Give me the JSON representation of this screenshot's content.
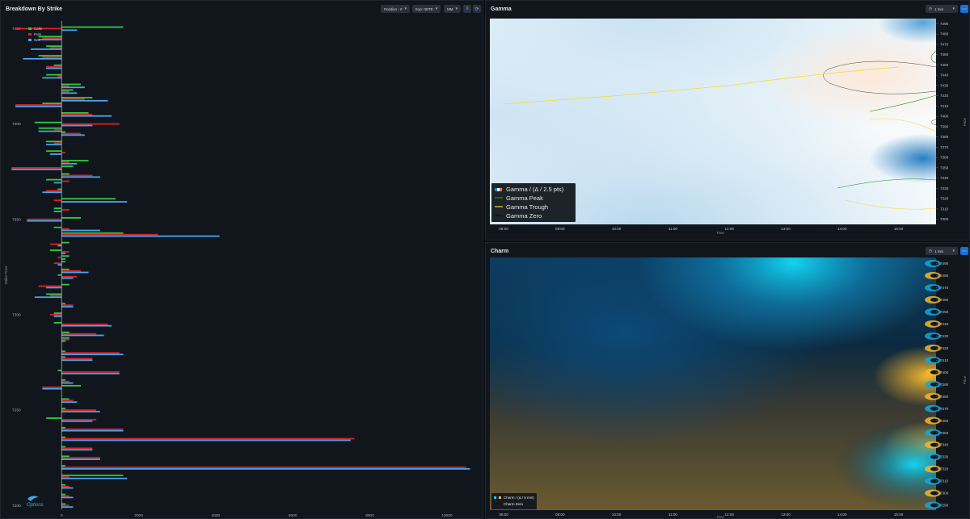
{
  "left_panel": {
    "title": "Breakdown By Strike",
    "position_select": "Position - #",
    "expiry_select": "Exp: 0DTE",
    "mm_select": "MM",
    "y_axis_label": "Strike Price",
    "legend": [
      {
        "label": "Calls",
        "color": "#2ecc3a"
      },
      {
        "label": "Puts",
        "color": "#e01f24"
      },
      {
        "label": "Net",
        "color": "#4aa3f0"
      }
    ],
    "logo_text": "Options"
  },
  "gamma_panel": {
    "title": "Gamma",
    "interval_select": "1 min",
    "x_axis_label": "Time",
    "y_axis_label": "Price",
    "legend": [
      {
        "label": "Gamma / (Δ / 2.5 pts)"
      },
      {
        "label": "Gamma Peak"
      },
      {
        "label": "Gamma Trough"
      },
      {
        "label": "Gamma Zero"
      }
    ]
  },
  "charm_panel": {
    "title": "Charm",
    "interval_select": "1 min",
    "x_axis_label": "Time",
    "y_axis_label": "Price",
    "legend": [
      {
        "label": "Charm / (Δ / 5 min)"
      },
      {
        "label": "Charm Zero"
      }
    ]
  },
  "colors": {
    "calls": "#2ecc3a",
    "puts": "#e01f24",
    "net": "#4aa3f0",
    "gamma_peak": "#1f8a1f",
    "gamma_trough": "#f0e030",
    "charm_positive": "#f2b630",
    "charm_negative": "#12d4f2"
  },
  "chart_data": [
    {
      "type": "bar",
      "orientation": "horizontal",
      "title": "Breakdown By Strike",
      "ylabel": "Strike Price",
      "y_tick_labels": [
        "7450",
        "7400",
        "7350",
        "7300",
        "7250",
        "7200"
      ],
      "x_tick_labels": [
        "0",
        "2000",
        "4000",
        "6000",
        "8000",
        "10000"
      ],
      "xlim": [
        -1200,
        10800
      ],
      "ylim": [
        7198,
        7454
      ],
      "series": [
        {
          "name": "Calls",
          "values": [
            [
              7450,
              1600
            ],
            [
              7445,
              -600
            ],
            [
              7440,
              -400
            ],
            [
              7435,
              -600
            ],
            [
              7430,
              -200
            ],
            [
              7425,
              -400
            ],
            [
              7420,
              500
            ],
            [
              7417,
              300
            ],
            [
              7413,
              800
            ],
            [
              7410,
              -500
            ],
            [
              7405,
              700
            ],
            [
              7400,
              -700
            ],
            [
              7397,
              -600
            ],
            [
              7395,
              100
            ],
            [
              7390,
              -400
            ],
            [
              7385,
              -400
            ],
            [
              7380,
              700
            ],
            [
              7377,
              300
            ],
            [
              7373,
              200
            ],
            [
              7370,
              -400
            ],
            [
              7365,
              -100
            ],
            [
              7360,
              1400
            ],
            [
              7355,
              -200
            ],
            [
              7350,
              500
            ],
            [
              7345,
              -200
            ],
            [
              7342,
              1600
            ],
            [
              7337,
              200
            ],
            [
              7333,
              -300
            ],
            [
              7330,
              200
            ],
            [
              7327,
              100
            ],
            [
              7323,
              200
            ],
            [
              7320,
              -100
            ],
            [
              7315,
              200
            ],
            [
              7310,
              -400
            ],
            [
              7305,
              100
            ],
            [
              7300,
              -200
            ],
            [
              7295,
              -200
            ],
            [
              7290,
              200
            ],
            [
              7287,
              200
            ],
            [
              7280,
              100
            ],
            [
              7277,
              100
            ],
            [
              7270,
              -100
            ],
            [
              7265,
              100
            ],
            [
              7262,
              500
            ],
            [
              7255,
              200
            ],
            [
              7250,
              100
            ],
            [
              7245,
              -400
            ],
            [
              7240,
              100
            ],
            [
              7235,
              100
            ],
            [
              7230,
              100
            ],
            [
              7225,
              200
            ],
            [
              7220,
              100
            ],
            [
              7215,
              1600
            ],
            [
              7210,
              100
            ],
            [
              7205,
              100
            ],
            [
              7200,
              100
            ]
          ]
        },
        {
          "name": "Puts",
          "values": [
            [
              7450,
              -1200
            ],
            [
              7445,
              -500
            ],
            [
              7440,
              -300
            ],
            [
              7435,
              -500
            ],
            [
              7430,
              -400
            ],
            [
              7425,
              -100
            ],
            [
              7420,
              200
            ],
            [
              7417,
              200
            ],
            [
              7413,
              600
            ],
            [
              7410,
              -1200
            ],
            [
              7405,
              800
            ],
            [
              7400,
              1500
            ],
            [
              7397,
              -200
            ],
            [
              7395,
              500
            ],
            [
              7390,
              -200
            ],
            [
              7385,
              100
            ],
            [
              7380,
              200
            ],
            [
              7377,
              -1300
            ],
            [
              7373,
              800
            ],
            [
              7370,
              200
            ],
            [
              7365,
              -400
            ],
            [
              7360,
              -200
            ],
            [
              7355,
              200
            ],
            [
              7350,
              -900
            ],
            [
              7345,
              200
            ],
            [
              7342,
              2500
            ],
            [
              7337,
              -300
            ],
            [
              7333,
              200
            ],
            [
              7330,
              -100
            ],
            [
              7327,
              -200
            ],
            [
              7323,
              500
            ],
            [
              7320,
              400
            ],
            [
              7315,
              -600
            ],
            [
              7310,
              -300
            ],
            [
              7305,
              300
            ],
            [
              7300,
              -300
            ],
            [
              7295,
              1200
            ],
            [
              7290,
              900
            ],
            [
              7287,
              200
            ],
            [
              7280,
              1500
            ],
            [
              7277,
              800
            ],
            [
              7270,
              1500
            ],
            [
              7265,
              200
            ],
            [
              7262,
              -500
            ],
            [
              7255,
              300
            ],
            [
              7250,
              900
            ],
            [
              7245,
              900
            ],
            [
              7240,
              1600
            ],
            [
              7235,
              7600
            ],
            [
              7230,
              800
            ],
            [
              7225,
              1000
            ],
            [
              7220,
              10500
            ],
            [
              7215,
              200
            ],
            [
              7210,
              200
            ],
            [
              7205,
              200
            ],
            [
              7200,
              200
            ]
          ]
        },
        {
          "name": "Net",
          "values": [
            [
              7450,
              400
            ],
            [
              7445,
              -600
            ],
            [
              7440,
              -800
            ],
            [
              7435,
              -1000
            ],
            [
              7430,
              -400
            ],
            [
              7425,
              -500
            ],
            [
              7420,
              600
            ],
            [
              7417,
              400
            ],
            [
              7413,
              1200
            ],
            [
              7410,
              -1200
            ],
            [
              7405,
              1300
            ],
            [
              7400,
              800
            ],
            [
              7397,
              -600
            ],
            [
              7395,
              600
            ],
            [
              7390,
              -400
            ],
            [
              7385,
              -300
            ],
            [
              7380,
              400
            ],
            [
              7377,
              -1300
            ],
            [
              7373,
              1000
            ],
            [
              7370,
              -200
            ],
            [
              7365,
              -500
            ],
            [
              7360,
              1700
            ],
            [
              7355,
              -200
            ],
            [
              7350,
              -900
            ],
            [
              7345,
              1000
            ],
            [
              7342,
              4100
            ],
            [
              7337,
              -100
            ],
            [
              7333,
              100
            ],
            [
              7330,
              100
            ],
            [
              7327,
              -100
            ],
            [
              7323,
              700
            ],
            [
              7320,
              300
            ],
            [
              7315,
              -400
            ],
            [
              7310,
              -700
            ],
            [
              7305,
              300
            ],
            [
              7300,
              -200
            ],
            [
              7295,
              1300
            ],
            [
              7290,
              1100
            ],
            [
              7287,
              100
            ],
            [
              7280,
              1600
            ],
            [
              7277,
              800
            ],
            [
              7270,
              1500
            ],
            [
              7265,
              300
            ],
            [
              7262,
              -500
            ],
            [
              7255,
              400
            ],
            [
              7250,
              1000
            ],
            [
              7245,
              800
            ],
            [
              7240,
              1600
            ],
            [
              7235,
              7500
            ],
            [
              7230,
              800
            ],
            [
              7225,
              1000
            ],
            [
              7220,
              10600
            ],
            [
              7215,
              1700
            ],
            [
              7210,
              300
            ],
            [
              7205,
              300
            ],
            [
              7200,
              300
            ]
          ]
        }
      ]
    },
    {
      "type": "heatmap",
      "title": "Gamma",
      "xlabel": "Time",
      "ylabel": "Price",
      "x_tick_labels": [
        "08:00",
        "09:00",
        "10:00",
        "11:00",
        "12:00",
        "13:00",
        "14:00",
        "15:00"
      ],
      "y_tick_labels": [
        "7490",
        "7480",
        "7470",
        "7460",
        "7450",
        "7440",
        "7430",
        "7420",
        "7410",
        "7400",
        "7390",
        "7380",
        "7370",
        "7360",
        "7350",
        "7340",
        "7330",
        "7320",
        "7310",
        "7300"
      ],
      "ylim": [
        7295,
        7495
      ],
      "gamma_trough_line": [
        [
          "08:00",
          7412
        ],
        [
          "10:00",
          7420
        ],
        [
          "12:00",
          7430
        ],
        [
          "13:00",
          7437
        ],
        [
          "14:00",
          7443
        ],
        [
          "15:00",
          7448
        ]
      ]
    },
    {
      "type": "heatmap",
      "title": "Charm",
      "xlabel": "Time",
      "ylabel": "Price",
      "x_tick_labels": [
        "08:00",
        "09:00",
        "10:00",
        "11:00",
        "12:00",
        "13:00",
        "14:00",
        "15:00"
      ],
      "y_tick_labels": [
        "7490",
        "7480",
        "7470",
        "7460",
        "7450",
        "7440",
        "7430",
        "7420",
        "7410",
        "7400",
        "7390",
        "7380",
        "7370",
        "7360",
        "7350",
        "7340",
        "7330",
        "7320",
        "7310",
        "7300",
        "7290"
      ],
      "ylim": [
        7286,
        7495
      ]
    }
  ]
}
